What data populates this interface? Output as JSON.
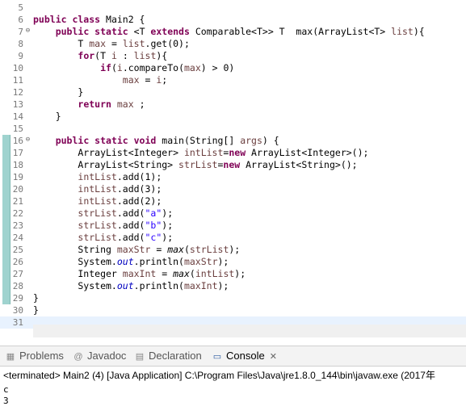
{
  "editor": {
    "lines": [
      {
        "num": "5",
        "fold": "",
        "marker": false,
        "highlight": false,
        "segs": []
      },
      {
        "num": "6",
        "fold": "",
        "marker": false,
        "highlight": false,
        "segs": [
          [
            "kw",
            "public class "
          ],
          [
            "",
            "Main2 {"
          ]
        ]
      },
      {
        "num": "7",
        "fold": "⊖",
        "marker": false,
        "highlight": false,
        "segs": [
          [
            "",
            "    "
          ],
          [
            "kw",
            "public static "
          ],
          [
            "",
            "<T "
          ],
          [
            "kw",
            "extends "
          ],
          [
            "",
            "Comparable<T>> T  max(ArrayList<T> "
          ],
          [
            "var",
            "list"
          ],
          [
            "",
            "){"
          ]
        ]
      },
      {
        "num": "8",
        "fold": "",
        "marker": false,
        "highlight": false,
        "segs": [
          [
            "",
            "        T "
          ],
          [
            "var",
            "max"
          ],
          [
            "",
            " = "
          ],
          [
            "var",
            "list"
          ],
          [
            "",
            ".get(0);"
          ]
        ]
      },
      {
        "num": "9",
        "fold": "",
        "marker": false,
        "highlight": false,
        "segs": [
          [
            "",
            "        "
          ],
          [
            "kw",
            "for"
          ],
          [
            "",
            "(T "
          ],
          [
            "var",
            "i"
          ],
          [
            "",
            " : "
          ],
          [
            "var",
            "list"
          ],
          [
            "",
            "){"
          ]
        ]
      },
      {
        "num": "10",
        "fold": "",
        "marker": false,
        "highlight": false,
        "segs": [
          [
            "",
            "            "
          ],
          [
            "kw",
            "if"
          ],
          [
            "",
            "("
          ],
          [
            "var",
            "i"
          ],
          [
            "",
            ".compareTo("
          ],
          [
            "var",
            "max"
          ],
          [
            "",
            ") > 0)"
          ]
        ]
      },
      {
        "num": "11",
        "fold": "",
        "marker": false,
        "highlight": false,
        "segs": [
          [
            "",
            "                "
          ],
          [
            "var",
            "max"
          ],
          [
            "",
            " = "
          ],
          [
            "var",
            "i"
          ],
          [
            "",
            ";"
          ]
        ]
      },
      {
        "num": "12",
        "fold": "",
        "marker": false,
        "highlight": false,
        "segs": [
          [
            "",
            "        }"
          ]
        ]
      },
      {
        "num": "13",
        "fold": "",
        "marker": false,
        "highlight": false,
        "segs": [
          [
            "",
            "        "
          ],
          [
            "kw",
            "return "
          ],
          [
            "var",
            "max"
          ],
          [
            "",
            " ;"
          ]
        ]
      },
      {
        "num": "14",
        "fold": "",
        "marker": false,
        "highlight": false,
        "segs": [
          [
            "",
            "    }"
          ]
        ]
      },
      {
        "num": "15",
        "fold": "",
        "marker": false,
        "highlight": false,
        "segs": []
      },
      {
        "num": "16",
        "fold": "⊖",
        "marker": true,
        "highlight": false,
        "segs": [
          [
            "",
            "    "
          ],
          [
            "kw",
            "public static void "
          ],
          [
            "",
            "main(String[] "
          ],
          [
            "var",
            "args"
          ],
          [
            "",
            ") {"
          ]
        ]
      },
      {
        "num": "17",
        "fold": "",
        "marker": true,
        "highlight": false,
        "segs": [
          [
            "",
            "        ArrayList<Integer> "
          ],
          [
            "var",
            "intList"
          ],
          [
            "",
            "="
          ],
          [
            "kw",
            "new "
          ],
          [
            "",
            "ArrayList<Integer>();"
          ]
        ]
      },
      {
        "num": "18",
        "fold": "",
        "marker": true,
        "highlight": false,
        "segs": [
          [
            "",
            "        ArrayList<String> "
          ],
          [
            "var",
            "strList"
          ],
          [
            "",
            "="
          ],
          [
            "kw",
            "new "
          ],
          [
            "",
            "ArrayList<String>();"
          ]
        ]
      },
      {
        "num": "19",
        "fold": "",
        "marker": true,
        "highlight": false,
        "segs": [
          [
            "",
            "        "
          ],
          [
            "var",
            "intList"
          ],
          [
            "",
            ".add(1);"
          ]
        ]
      },
      {
        "num": "20",
        "fold": "",
        "marker": true,
        "highlight": false,
        "segs": [
          [
            "",
            "        "
          ],
          [
            "var",
            "intList"
          ],
          [
            "",
            ".add(3);"
          ]
        ]
      },
      {
        "num": "21",
        "fold": "",
        "marker": true,
        "highlight": false,
        "segs": [
          [
            "",
            "        "
          ],
          [
            "var",
            "intList"
          ],
          [
            "",
            ".add(2);"
          ]
        ]
      },
      {
        "num": "22",
        "fold": "",
        "marker": true,
        "highlight": false,
        "segs": [
          [
            "",
            "        "
          ],
          [
            "var",
            "strList"
          ],
          [
            "",
            ".add("
          ],
          [
            "str",
            "\"a\""
          ],
          [
            "",
            ");"
          ]
        ]
      },
      {
        "num": "23",
        "fold": "",
        "marker": true,
        "highlight": false,
        "segs": [
          [
            "",
            "        "
          ],
          [
            "var",
            "strList"
          ],
          [
            "",
            ".add("
          ],
          [
            "str",
            "\"b\""
          ],
          [
            "",
            ");"
          ]
        ]
      },
      {
        "num": "24",
        "fold": "",
        "marker": true,
        "highlight": false,
        "segs": [
          [
            "",
            "        "
          ],
          [
            "var",
            "strList"
          ],
          [
            "",
            ".add("
          ],
          [
            "str",
            "\"c\""
          ],
          [
            "",
            ");"
          ]
        ]
      },
      {
        "num": "25",
        "fold": "",
        "marker": true,
        "highlight": false,
        "segs": [
          [
            "",
            "        String "
          ],
          [
            "var",
            "maxStr"
          ],
          [
            "",
            " = "
          ],
          [
            "ital",
            "max"
          ],
          [
            "",
            "("
          ],
          [
            "var",
            "strList"
          ],
          [
            "",
            ");"
          ]
        ]
      },
      {
        "num": "26",
        "fold": "",
        "marker": true,
        "highlight": false,
        "segs": [
          [
            "",
            "        System."
          ],
          [
            "fld",
            "out"
          ],
          [
            "",
            ".println("
          ],
          [
            "var",
            "maxStr"
          ],
          [
            "",
            ");"
          ]
        ]
      },
      {
        "num": "27",
        "fold": "",
        "marker": true,
        "highlight": false,
        "segs": [
          [
            "",
            "        Integer "
          ],
          [
            "var",
            "maxInt"
          ],
          [
            "",
            " = "
          ],
          [
            "ital",
            "max"
          ],
          [
            "",
            "("
          ],
          [
            "var",
            "intList"
          ],
          [
            "",
            ");"
          ]
        ]
      },
      {
        "num": "28",
        "fold": "",
        "marker": true,
        "highlight": false,
        "segs": [
          [
            "",
            "        System."
          ],
          [
            "fld",
            "out"
          ],
          [
            "",
            ".println("
          ],
          [
            "var",
            "maxInt"
          ],
          [
            "",
            ");"
          ]
        ]
      },
      {
        "num": "29",
        "fold": "",
        "marker": true,
        "highlight": false,
        "segs": [
          [
            "",
            "}"
          ]
        ]
      },
      {
        "num": "30",
        "fold": "",
        "marker": false,
        "highlight": false,
        "segs": [
          [
            "",
            "}"
          ]
        ]
      },
      {
        "num": "31",
        "fold": "",
        "marker": false,
        "highlight": true,
        "segs": []
      }
    ]
  },
  "tabs": {
    "problems": {
      "label": "Problems",
      "icon": "problems-icon"
    },
    "javadoc": {
      "label": "Javadoc",
      "icon": "javadoc-icon"
    },
    "declaration": {
      "label": "Declaration",
      "icon": "declaration-icon"
    },
    "console": {
      "label": "Console",
      "icon": "console-icon",
      "close": "✕"
    }
  },
  "console": {
    "header": "<terminated> Main2 (4) [Java Application] C:\\Program Files\\Java\\jre1.8.0_144\\bin\\javaw.exe (2017年",
    "output": [
      "c",
      "3"
    ]
  }
}
